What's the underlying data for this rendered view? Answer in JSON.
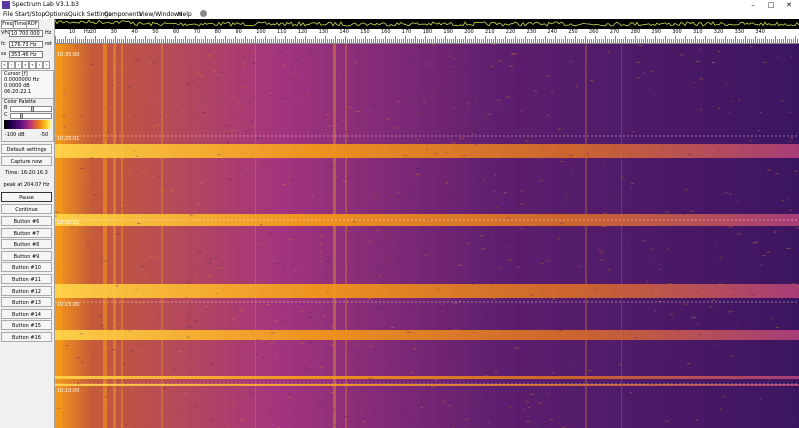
{
  "window": {
    "title": "Spectrum Lab V3.1.b3",
    "controls": {
      "minimize": "–",
      "maximize": "□",
      "close": "✕"
    }
  },
  "menu": [
    "File",
    "Start/Stop",
    "Options",
    "Quick Settings",
    "Components",
    "View/Windows",
    "Help"
  ],
  "left_panel": {
    "tabs": [
      "Freq",
      "Time",
      "RDF"
    ],
    "rows": [
      {
        "label": "VFO",
        "value": "10 700 000",
        "unit": "Hz"
      },
      {
        "label": "fc",
        "value": "176.73 Hz",
        "unit": "ret"
      },
      {
        "label": "ss",
        "value": "353.46 Hz",
        "unit": ""
      }
    ],
    "nav_buttons": [
      "«",
      "‹",
      "›",
      "»",
      "«",
      "‹",
      "›"
    ],
    "cursor": {
      "title": "Cursor [f]",
      "freq": "0.0000000 Hz",
      "level": "0.0000 dB",
      "time": "06:20:22.1"
    },
    "palette": {
      "title": "Color Palette",
      "b_label": "B",
      "c_label": "C",
      "min": "-100 dB",
      "max": "-50",
      "b_level": 0.55,
      "c_level": 0.25
    },
    "buttons": [
      {
        "id": "default-settings",
        "label": "Default settings"
      },
      {
        "id": "capture-now",
        "label": "Capture now"
      }
    ],
    "time_text": "Time:  16:20:16.3",
    "peak_text": "peak at 204.07 Hz",
    "control_buttons": [
      "Pause",
      "Continue"
    ],
    "user_buttons": [
      "Button #6",
      "Button #7",
      "Button #8",
      "Button #9",
      "Button #10",
      "Button #11",
      "Button #12",
      "Button #13",
      "Button #14",
      "Button #15",
      "Button #16"
    ]
  },
  "scale": {
    "unit": "Hz",
    "ticks": [
      "10",
      "20",
      "30",
      "40",
      "50",
      "60",
      "70",
      "80",
      "90",
      "100",
      "110",
      "120",
      "130",
      "140",
      "150",
      "160",
      "170",
      "180",
      "190",
      "200",
      "210",
      "220",
      "230",
      "240",
      "250",
      "260",
      "270",
      "280",
      "290",
      "300",
      "310",
      "320",
      "330",
      "340"
    ]
  },
  "waterfall": {
    "time_markers": [
      "10:35:00",
      "10:25:01",
      "10:20:01",
      "10:15:00",
      "10:10:00"
    ],
    "colors": {
      "bg": "#3c1560",
      "mid": "#a3357e",
      "hot": "#f59a18",
      "peak": "#ffd64a"
    }
  }
}
